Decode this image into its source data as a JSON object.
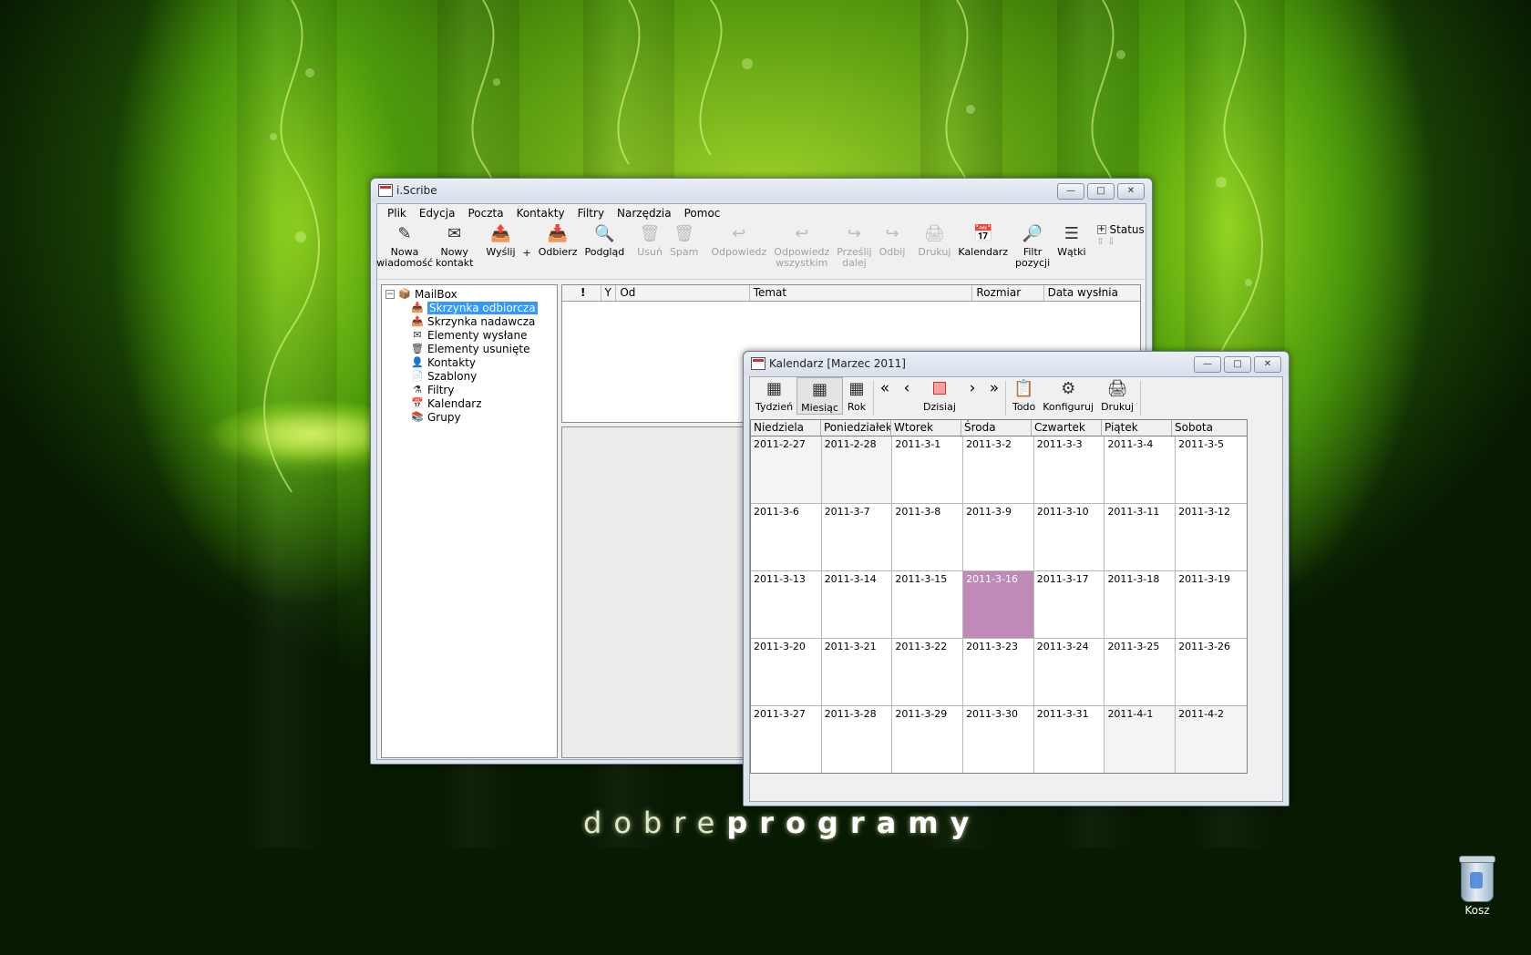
{
  "desktop": {
    "brand_light": "dobre",
    "brand_bold": "programy",
    "recycle_bin_label": "Kosz"
  },
  "mail_window": {
    "title": "i.Scribe",
    "menu": [
      "Plik",
      "Edycja",
      "Poczta",
      "Kontakty",
      "Filtry",
      "Narzędzia",
      "Pomoc"
    ],
    "toolbar": {
      "new_message": "Nowa wiadomość",
      "new_contact": "Nowy kontakt",
      "send": "Wyślij",
      "plus": "+",
      "receive": "Odbierz",
      "preview": "Podgląd",
      "delete": "Usuń",
      "spam": "Spam",
      "reply": "Odpowiedz",
      "reply_all": "Odpowiedz wszystkim",
      "forward": "Prześlij dalej",
      "bounce": "Odbij",
      "print": "Drukuj",
      "calendar": "Kalendarz",
      "filter": "Filtr pozycji",
      "threads": "Wątki",
      "status": "Status"
    },
    "folders": {
      "root": "MailBox",
      "inbox": "Skrzynka odbiorcza",
      "outbox": "Skrzynka nadawcza",
      "sent": "Elementy wysłane",
      "deleted": "Elementy usunięte",
      "contacts": "Kontakty",
      "templates": "Szablony",
      "filters": "Filtry",
      "calendar": "Kalendarz",
      "groups": "Grupy"
    },
    "columns": {
      "priority": "!",
      "flag": "Y",
      "from": "Od",
      "subject": "Temat",
      "size": "Rozmiar",
      "date": "Data wysłnia"
    }
  },
  "calendar_window": {
    "title": "Kalendarz [Marzec 2011]",
    "toolbar": {
      "week": "Tydzień",
      "month": "Miesiąc",
      "year": "Rok",
      "first": "«",
      "prev": "‹",
      "next": "›",
      "last": "»",
      "today": "Dzisiaj",
      "todo": "Todo",
      "configure": "Konfiguruj",
      "print": "Drukuj"
    },
    "days": [
      "Niedziela",
      "Poniedziałek",
      "Wtorek",
      "Środa",
      "Czwartek",
      "Piątek",
      "Sobota"
    ],
    "weeks": [
      [
        "2011-2-27",
        "2011-2-28",
        "2011-3-1",
        "2011-3-2",
        "2011-3-3",
        "2011-3-4",
        "2011-3-5"
      ],
      [
        "2011-3-6",
        "2011-3-7",
        "2011-3-8",
        "2011-3-9",
        "2011-3-10",
        "2011-3-11",
        "2011-3-12"
      ],
      [
        "2011-3-13",
        "2011-3-14",
        "2011-3-15",
        "2011-3-16",
        "2011-3-17",
        "2011-3-18",
        "2011-3-19"
      ],
      [
        "2011-3-20",
        "2011-3-21",
        "2011-3-22",
        "2011-3-23",
        "2011-3-24",
        "2011-3-25",
        "2011-3-26"
      ],
      [
        "2011-3-27",
        "2011-3-28",
        "2011-3-29",
        "2011-3-30",
        "2011-3-31",
        "2011-4-1",
        "2011-4-2"
      ]
    ],
    "today": "2011-3-16",
    "today_color": "#c08ab8"
  }
}
